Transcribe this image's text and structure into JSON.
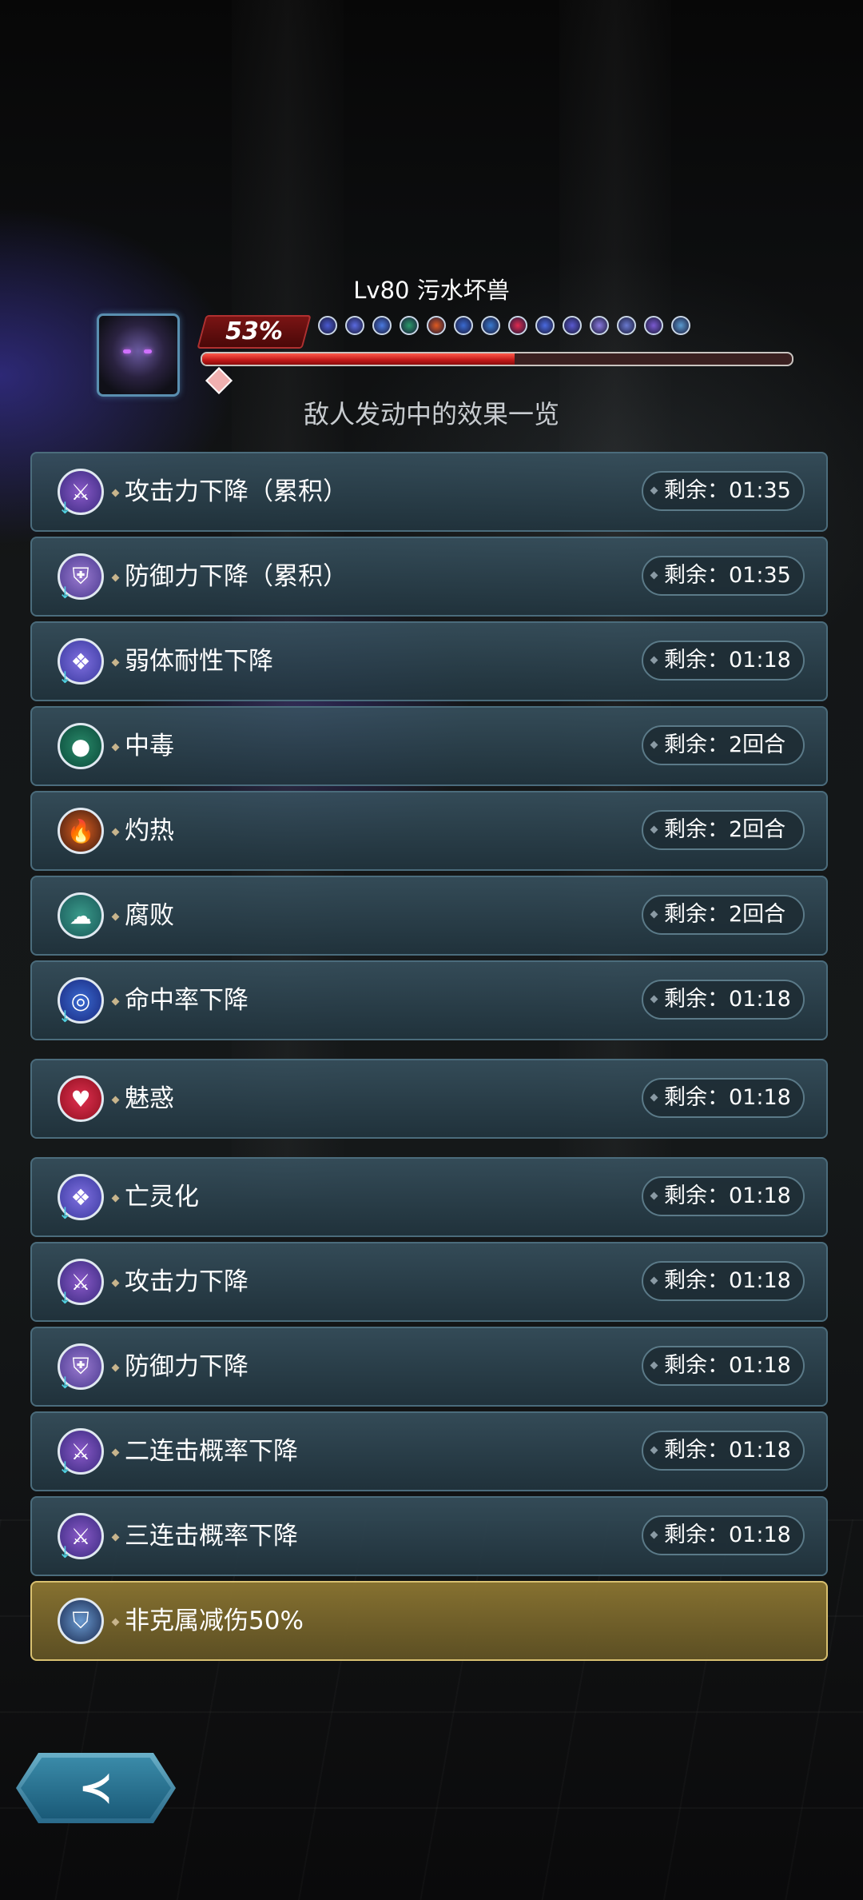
{
  "enemy": {
    "name": "Lv80 污水坏兽",
    "hp_percent_label": "53%",
    "hp_fraction": 0.53
  },
  "subtitle": "敌人发动中的效果一览",
  "status_icon_colors": [
    "#4a5ad0",
    "#5a6ae0",
    "#4a7ae0",
    "#2a9a6a",
    "#e05a20",
    "#3a6ad0",
    "#3a7ad0",
    "#e02a50",
    "#4a6ae0",
    "#5a5ad0",
    "#8a7ae0",
    "#6a7ad0",
    "#7a5ad0",
    "#5a9ad0"
  ],
  "effects": [
    {
      "label": "攻击力下降（累积）",
      "timer": "剩余：01:35",
      "icon": "sword-down-icon",
      "glyph": "⚔",
      "down": true,
      "cls": "ic-sword"
    },
    {
      "label": "防御力下降（累积）",
      "timer": "剩余：01:35",
      "icon": "shield-down-icon",
      "glyph": "⛨",
      "down": true,
      "cls": "ic-shield"
    },
    {
      "label": "弱体耐性下降",
      "timer": "剩余：01:18",
      "icon": "diamond-down-icon",
      "glyph": "❖",
      "down": true,
      "cls": "ic-diamond"
    },
    {
      "label": "中毒",
      "timer": "剩余：2回合",
      "icon": "poison-icon",
      "glyph": "●",
      "down": false,
      "cls": "ic-poison"
    },
    {
      "label": "灼热",
      "timer": "剩余：2回合",
      "icon": "fire-icon",
      "glyph": "🔥",
      "down": false,
      "cls": "ic-fire"
    },
    {
      "label": "腐败",
      "timer": "剩余：2回合",
      "icon": "ghost-icon",
      "glyph": "☁",
      "down": false,
      "cls": "ic-ghost"
    },
    {
      "label": "命中率下降",
      "timer": "剩余：01:18",
      "icon": "target-down-icon",
      "glyph": "◎",
      "down": true,
      "cls": "ic-target"
    },
    {
      "label": "魅惑",
      "timer": "剩余：01:18",
      "icon": "heart-icon",
      "glyph": "♥",
      "down": false,
      "cls": "ic-heart"
    },
    {
      "label": "亡灵化",
      "timer": "剩余：01:18",
      "icon": "diamond-down-icon",
      "glyph": "❖",
      "down": true,
      "cls": "ic-diamond"
    },
    {
      "label": "攻击力下降",
      "timer": "剩余：01:18",
      "icon": "sword-down-icon",
      "glyph": "⚔",
      "down": true,
      "cls": "ic-sword"
    },
    {
      "label": "防御力下降",
      "timer": "剩余：01:18",
      "icon": "shield-down-icon",
      "glyph": "⛨",
      "down": true,
      "cls": "ic-shield"
    },
    {
      "label": "二连击概率下降",
      "timer": "剩余：01:18",
      "icon": "double-sword-down-icon",
      "glyph": "⚔",
      "down": true,
      "cls": "ic-sword"
    },
    {
      "label": "三连击概率下降",
      "timer": "剩余：01:18",
      "icon": "triple-sword-down-icon",
      "glyph": "⚔",
      "down": true,
      "cls": "ic-sword"
    },
    {
      "label": "非克属减伤50%",
      "timer": "",
      "icon": "guard-shield-icon",
      "glyph": "⛉",
      "down": false,
      "cls": "ic-guard",
      "highlight": true
    }
  ],
  "back_button": {
    "glyph": "≺"
  }
}
